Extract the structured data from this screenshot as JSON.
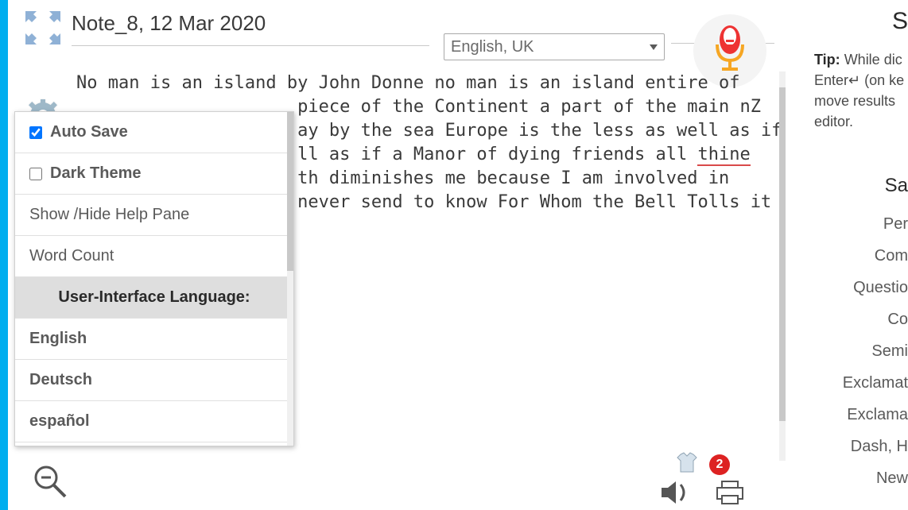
{
  "title": "Note_8, 12 Mar 2020",
  "language_selected": "English, UK",
  "doc_lines": [
    "No man is an island by John Donne no man is an island entire of",
    "                     piece of the Continent a part of the main nZ",
    "                     ay by the sea Europe is the less as well as if",
    "                     ll as if a Manor of dying friends all ",
    "                     th diminishes me because I am involved in",
    "                     never send to know For Whom the Bell Tolls it"
  ],
  "underlined_word": "thine",
  "settings_menu": {
    "auto_save": {
      "label": "Auto Save",
      "checked": true
    },
    "dark_theme": {
      "label": "Dark Theme",
      "checked": false
    },
    "show_help": "Show /Hide Help Pane",
    "word_count": "Word Count",
    "ui_lang_header": "User-Interface Language:",
    "languages": [
      "English",
      "Deutsch",
      "español"
    ]
  },
  "right_panel": {
    "heading_fragment": "S",
    "tip_label": "Tip:",
    "tip_text_lines": [
      "While dic",
      "Enter↵ (on ke",
      "move results",
      "editor."
    ],
    "punct_heading": "Sa",
    "punct_items": [
      "Per",
      "Com",
      "Questio",
      "Co",
      "Semi",
      "Exclamat",
      "Exclama",
      "Dash, H",
      "New"
    ]
  },
  "badge_count": "2"
}
